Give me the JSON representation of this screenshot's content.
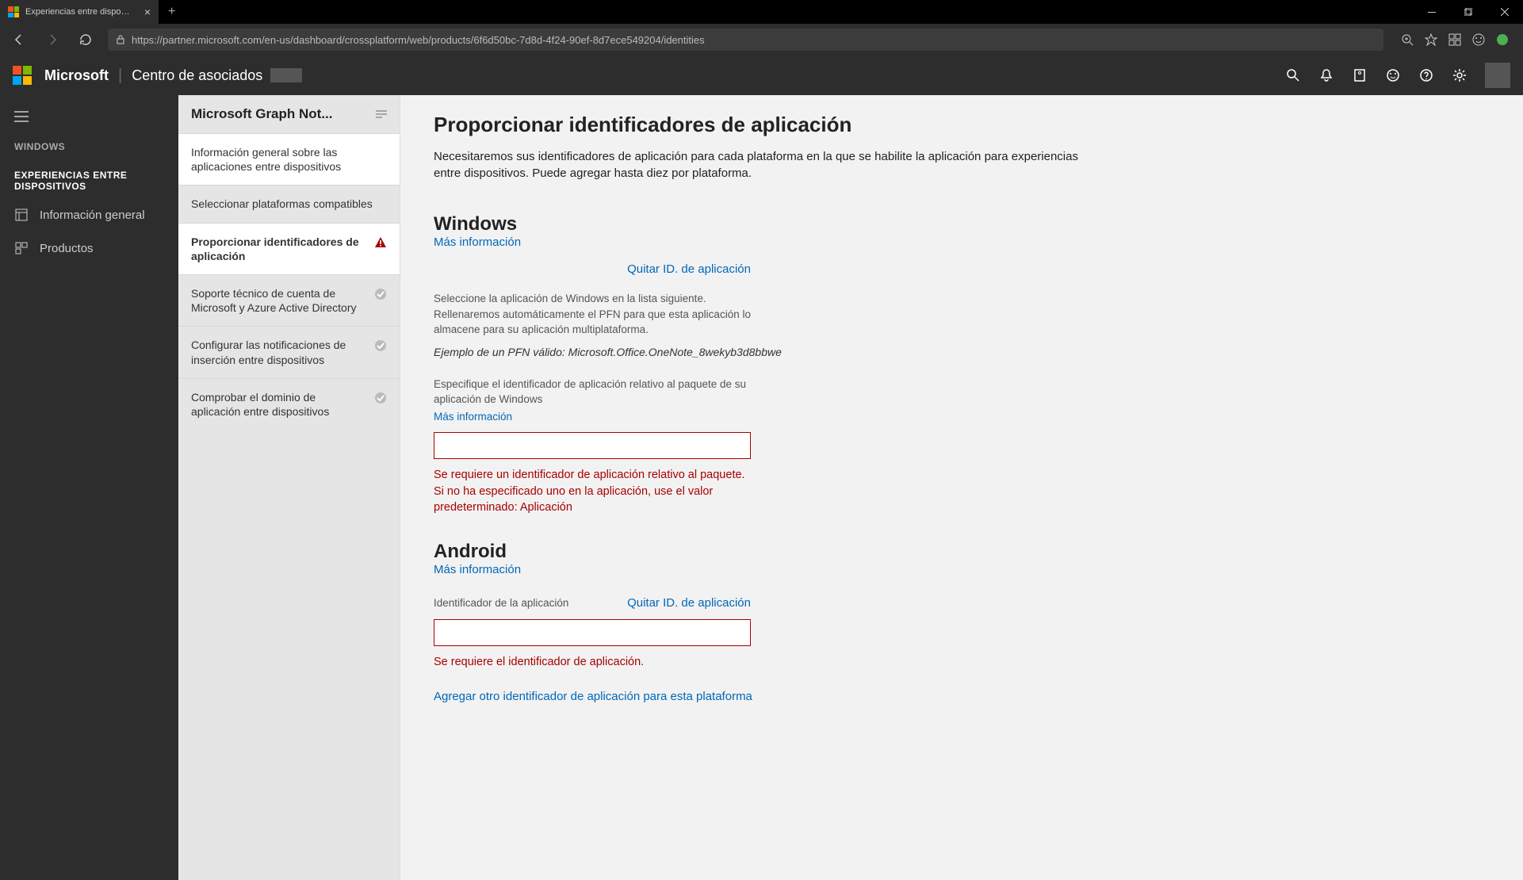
{
  "browser": {
    "tab_title": "Experiencias entre dispositivos",
    "url": "https://partner.microsoft.com/en-us/dashboard/crossplatform/web/products/6f6d50bc-7d8d-4f24-90ef-8d7ece549204/identities"
  },
  "header": {
    "brand": "Microsoft",
    "product": "Centro de asociados"
  },
  "sidebar": {
    "section1_label": "WINDOWS",
    "section2_label": "EXPERIENCIAS ENTRE DISPOSITIVOS",
    "items": [
      {
        "label": "Información general"
      },
      {
        "label": "Productos"
      }
    ]
  },
  "sub": {
    "title": "Microsoft Graph Not...",
    "items": [
      {
        "label": "Información general sobre las aplicaciones entre dispositivos",
        "status": "none",
        "selected": true
      },
      {
        "label": "Seleccionar plataformas compatibles",
        "status": "none"
      },
      {
        "label": "Proporcionar identificadores de aplicación",
        "status": "warn",
        "active": true
      },
      {
        "label": "Soporte técnico de cuenta de Microsoft y Azure Active Directory",
        "status": "ok"
      },
      {
        "label": "Configurar las notificaciones de inserción entre dispositivos",
        "status": "ok"
      },
      {
        "label": "Comprobar el dominio de aplicación entre dispositivos",
        "status": "ok"
      }
    ]
  },
  "content": {
    "title": "Proporcionar identificadores de aplicación",
    "desc": "Necesitaremos sus identificadores de aplicación para cada plataforma en la que se habilite la aplicación para experiencias entre dispositivos. Puede agregar hasta diez por plataforma.",
    "more_info": "Más información",
    "remove_id": "Quitar ID. de aplicación",
    "windows": {
      "title": "Windows",
      "helper": "Seleccione la aplicación de Windows en la lista siguiente. Rellenaremos automáticamente el PFN para que esta aplicación lo almacene para su aplicación multiplataforma.",
      "example": "Ejemplo de un PFN válido: Microsoft.Office.OneNote_8wekyb3d8bbwe",
      "field_label": "Especifique el identificador de aplicación relativo al paquete de su aplicación de Windows",
      "value": "",
      "error": "Se requiere un identificador de aplicación relativo al paquete. Si no ha especificado uno en la aplicación, use el valor predeterminado: Aplicación"
    },
    "android": {
      "title": "Android",
      "field_label": "Identificador de la aplicación",
      "value": "",
      "error": "Se requiere el identificador de aplicación.",
      "add_another": "Agregar otro identificador de aplicación para esta plataforma"
    }
  }
}
